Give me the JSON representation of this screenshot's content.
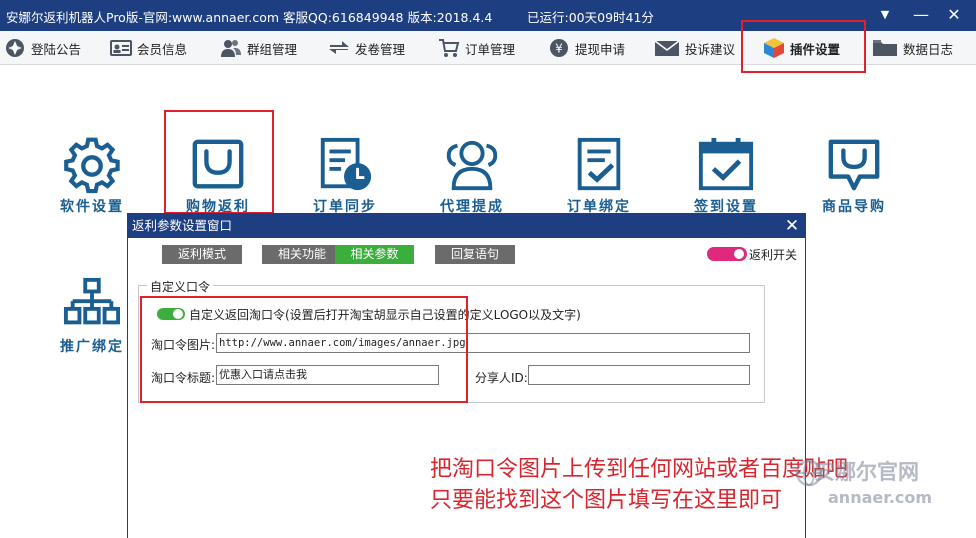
{
  "window": {
    "title": "安娜尔返利机器人Pro版-官网:www.annaer.com 客服QQ:616849948  版本:2018.4.4",
    "runtime": "已运行:00天09时41分",
    "controls": {
      "menu": "▼",
      "minimize": "—",
      "close": "✕"
    }
  },
  "menu": {
    "items": [
      {
        "label": "登陆公告",
        "icon": "announcement-icon"
      },
      {
        "label": "会员信息",
        "icon": "id-card-icon"
      },
      {
        "label": "群组管理",
        "icon": "users-icon"
      },
      {
        "label": "发卷管理",
        "icon": "coupon-icon"
      },
      {
        "label": "订单管理",
        "icon": "cart-icon"
      },
      {
        "label": "提现申请",
        "icon": "coin-icon"
      },
      {
        "label": "投诉建议",
        "icon": "mail-icon"
      },
      {
        "label": "插件设置",
        "icon": "cube-icon"
      },
      {
        "label": "数据日志",
        "icon": "folder-icon"
      }
    ]
  },
  "tiles": [
    {
      "label": "软件设置",
      "icon": "gear-icon"
    },
    {
      "label": "购物返利",
      "icon": "shopping-bag-icon"
    },
    {
      "label": "订单同步",
      "icon": "document-clock-icon"
    },
    {
      "label": "代理提成",
      "icon": "users-icon"
    },
    {
      "label": "订单绑定",
      "icon": "document-check-icon"
    },
    {
      "label": "签到设置",
      "icon": "calendar-check-icon"
    },
    {
      "label": "商品导购",
      "icon": "bag-icon"
    },
    {
      "label": "推广绑定",
      "icon": "org-chart-icon"
    }
  ],
  "dialog": {
    "title": "返利参数设置窗口",
    "close": "✕",
    "tabs": [
      "返利模式",
      "相关功能",
      "相关参数",
      "回复语句"
    ],
    "active_tab": "相关参数",
    "rebate_switch_label": "返利开关",
    "group_title": "自定义口令",
    "custom_toggle_label": "自定义返回淘口令(设置后打开淘宝胡显示自己设置的定义LOGO以及文字)",
    "image_label": "淘口令图片:",
    "image_value": "http://www.annaer.com/images/annaer.jpg",
    "title_label": "淘口令标题:",
    "title_value": "优惠入口请点击我",
    "sharer_label": "分享人ID:",
    "sharer_value": ""
  },
  "annotation": {
    "line1": "把淘口令图片上传到任何网站或者百度贴吧",
    "line2": "只要能找到这个图片填写在这里即可"
  },
  "watermark": {
    "line1": "安娜尔官网",
    "line2": "annaer.com"
  },
  "colors": {
    "titlebar": "#1d3f82",
    "icon_blue": "#1a5e92",
    "highlight": "#e0202a",
    "tab_active": "#3cae3c",
    "switch_pink": "#e0287c",
    "switch_green": "#3cae3c"
  }
}
